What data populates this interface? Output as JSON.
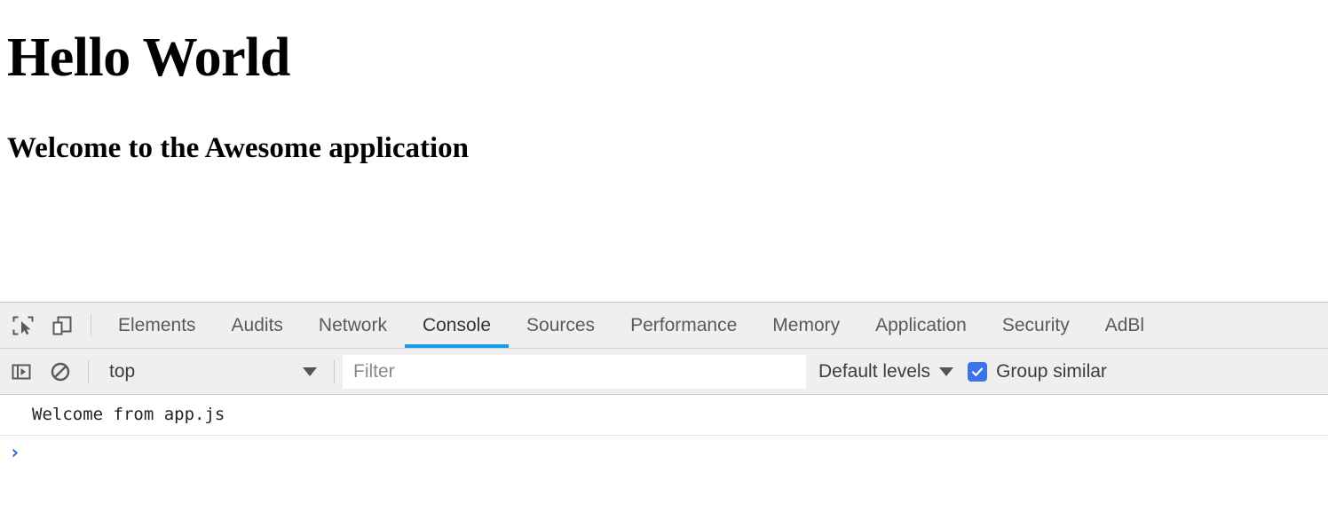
{
  "page": {
    "heading": "Hello World",
    "subheading": "Welcome to the Awesome application"
  },
  "devtools": {
    "inspect_icon": "inspect-element-icon",
    "device_icon": "device-toolbar-icon",
    "tabs": [
      {
        "label": "Elements",
        "active": false
      },
      {
        "label": "Audits",
        "active": false
      },
      {
        "label": "Network",
        "active": false
      },
      {
        "label": "Console",
        "active": true
      },
      {
        "label": "Sources",
        "active": false
      },
      {
        "label": "Performance",
        "active": false
      },
      {
        "label": "Memory",
        "active": false
      },
      {
        "label": "Application",
        "active": false
      },
      {
        "label": "Security",
        "active": false
      },
      {
        "label": "AdBl",
        "active": false
      }
    ],
    "active_tab": "Console",
    "console_toolbar": {
      "sidebar_icon": "show-console-sidebar-icon",
      "clear_icon": "clear-console-icon",
      "context": "top",
      "context_caret": "chevron-down-icon",
      "filter_placeholder": "Filter",
      "filter_value": "",
      "levels_label": "Default levels",
      "levels_caret": "chevron-down-icon",
      "group_similar_label": "Group similar",
      "group_similar_checked": true
    },
    "console_messages": [
      {
        "text": "Welcome from app.js",
        "level": "log"
      }
    ],
    "prompt_symbol": "›",
    "prompt_value": ""
  },
  "colors": {
    "accent_tab_underline": "#179cec",
    "accent_checkbox": "#3b73e8",
    "prompt_arrow": "#2962d9",
    "toolbar_bg": "#efefef",
    "page_bg": "#ffffff"
  }
}
